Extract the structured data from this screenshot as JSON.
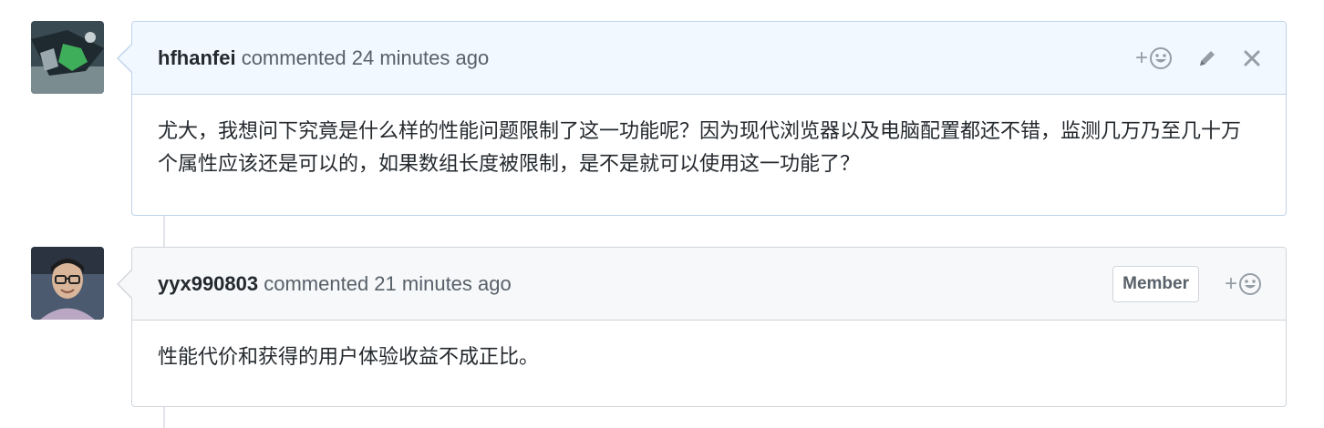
{
  "comments": [
    {
      "author": "hfhanfei",
      "meta": "commented 24 minutes ago",
      "body": "尤大，我想问下究竟是什么样的性能问题限制了这一功能呢？因为现代浏览器以及电脑配置都还不错，监测几万乃至几十万个属性应该还是可以的，如果数组长度被限制，是不是就可以使用这一功能了？",
      "reaction_plus": "+",
      "icons": [
        "smiley-icon",
        "pencil-icon",
        "close-icon"
      ]
    },
    {
      "author": "yyx990803",
      "meta": "commented 21 minutes ago",
      "badge": "Member",
      "body": "性能代价和获得的用户体验收益不成正比。",
      "reaction_plus": "+",
      "icons": [
        "smiley-icon"
      ]
    }
  ],
  "colors": {
    "own_header_bg": "#f1f8ff",
    "header_bg": "#f6f8fa",
    "border": "#d1d5da",
    "own_border": "#c0d3eb"
  }
}
